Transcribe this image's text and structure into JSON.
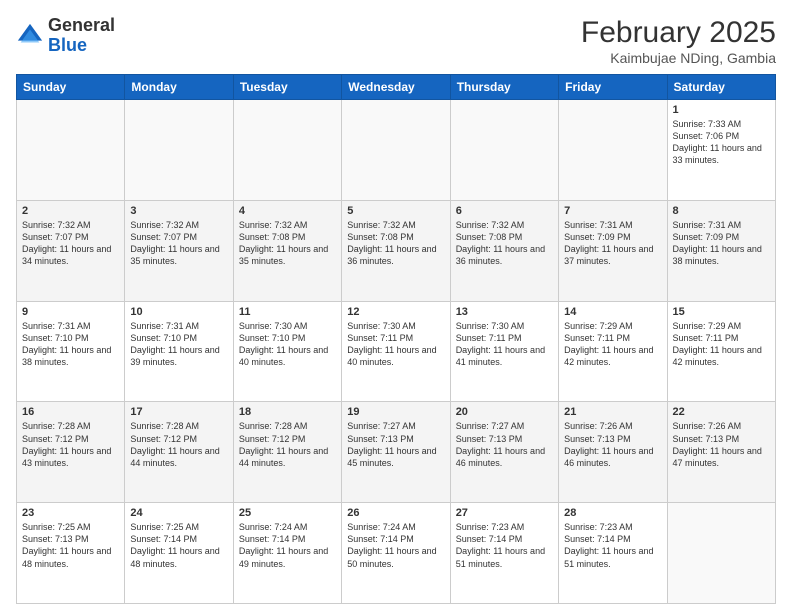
{
  "logo": {
    "general": "General",
    "blue": "Blue"
  },
  "header": {
    "month_year": "February 2025",
    "location": "Kaimbujae NDing, Gambia"
  },
  "days_of_week": [
    "Sunday",
    "Monday",
    "Tuesday",
    "Wednesday",
    "Thursday",
    "Friday",
    "Saturday"
  ],
  "weeks": [
    {
      "alt": false,
      "days": [
        {
          "num": "",
          "info": ""
        },
        {
          "num": "",
          "info": ""
        },
        {
          "num": "",
          "info": ""
        },
        {
          "num": "",
          "info": ""
        },
        {
          "num": "",
          "info": ""
        },
        {
          "num": "",
          "info": ""
        },
        {
          "num": "1",
          "info": "Sunrise: 7:33 AM\nSunset: 7:06 PM\nDaylight: 11 hours\nand 33 minutes."
        }
      ]
    },
    {
      "alt": true,
      "days": [
        {
          "num": "2",
          "info": "Sunrise: 7:32 AM\nSunset: 7:07 PM\nDaylight: 11 hours\nand 34 minutes."
        },
        {
          "num": "3",
          "info": "Sunrise: 7:32 AM\nSunset: 7:07 PM\nDaylight: 11 hours\nand 35 minutes."
        },
        {
          "num": "4",
          "info": "Sunrise: 7:32 AM\nSunset: 7:08 PM\nDaylight: 11 hours\nand 35 minutes."
        },
        {
          "num": "5",
          "info": "Sunrise: 7:32 AM\nSunset: 7:08 PM\nDaylight: 11 hours\nand 36 minutes."
        },
        {
          "num": "6",
          "info": "Sunrise: 7:32 AM\nSunset: 7:08 PM\nDaylight: 11 hours\nand 36 minutes."
        },
        {
          "num": "7",
          "info": "Sunrise: 7:31 AM\nSunset: 7:09 PM\nDaylight: 11 hours\nand 37 minutes."
        },
        {
          "num": "8",
          "info": "Sunrise: 7:31 AM\nSunset: 7:09 PM\nDaylight: 11 hours\nand 38 minutes."
        }
      ]
    },
    {
      "alt": false,
      "days": [
        {
          "num": "9",
          "info": "Sunrise: 7:31 AM\nSunset: 7:10 PM\nDaylight: 11 hours\nand 38 minutes."
        },
        {
          "num": "10",
          "info": "Sunrise: 7:31 AM\nSunset: 7:10 PM\nDaylight: 11 hours\nand 39 minutes."
        },
        {
          "num": "11",
          "info": "Sunrise: 7:30 AM\nSunset: 7:10 PM\nDaylight: 11 hours\nand 40 minutes."
        },
        {
          "num": "12",
          "info": "Sunrise: 7:30 AM\nSunset: 7:11 PM\nDaylight: 11 hours\nand 40 minutes."
        },
        {
          "num": "13",
          "info": "Sunrise: 7:30 AM\nSunset: 7:11 PM\nDaylight: 11 hours\nand 41 minutes."
        },
        {
          "num": "14",
          "info": "Sunrise: 7:29 AM\nSunset: 7:11 PM\nDaylight: 11 hours\nand 42 minutes."
        },
        {
          "num": "15",
          "info": "Sunrise: 7:29 AM\nSunset: 7:11 PM\nDaylight: 11 hours\nand 42 minutes."
        }
      ]
    },
    {
      "alt": true,
      "days": [
        {
          "num": "16",
          "info": "Sunrise: 7:28 AM\nSunset: 7:12 PM\nDaylight: 11 hours\nand 43 minutes."
        },
        {
          "num": "17",
          "info": "Sunrise: 7:28 AM\nSunset: 7:12 PM\nDaylight: 11 hours\nand 44 minutes."
        },
        {
          "num": "18",
          "info": "Sunrise: 7:28 AM\nSunset: 7:12 PM\nDaylight: 11 hours\nand 44 minutes."
        },
        {
          "num": "19",
          "info": "Sunrise: 7:27 AM\nSunset: 7:13 PM\nDaylight: 11 hours\nand 45 minutes."
        },
        {
          "num": "20",
          "info": "Sunrise: 7:27 AM\nSunset: 7:13 PM\nDaylight: 11 hours\nand 46 minutes."
        },
        {
          "num": "21",
          "info": "Sunrise: 7:26 AM\nSunset: 7:13 PM\nDaylight: 11 hours\nand 46 minutes."
        },
        {
          "num": "22",
          "info": "Sunrise: 7:26 AM\nSunset: 7:13 PM\nDaylight: 11 hours\nand 47 minutes."
        }
      ]
    },
    {
      "alt": false,
      "days": [
        {
          "num": "23",
          "info": "Sunrise: 7:25 AM\nSunset: 7:13 PM\nDaylight: 11 hours\nand 48 minutes."
        },
        {
          "num": "24",
          "info": "Sunrise: 7:25 AM\nSunset: 7:14 PM\nDaylight: 11 hours\nand 48 minutes."
        },
        {
          "num": "25",
          "info": "Sunrise: 7:24 AM\nSunset: 7:14 PM\nDaylight: 11 hours\nand 49 minutes."
        },
        {
          "num": "26",
          "info": "Sunrise: 7:24 AM\nSunset: 7:14 PM\nDaylight: 11 hours\nand 50 minutes."
        },
        {
          "num": "27",
          "info": "Sunrise: 7:23 AM\nSunset: 7:14 PM\nDaylight: 11 hours\nand 51 minutes."
        },
        {
          "num": "28",
          "info": "Sunrise: 7:23 AM\nSunset: 7:14 PM\nDaylight: 11 hours\nand 51 minutes."
        },
        {
          "num": "",
          "info": ""
        }
      ]
    }
  ]
}
